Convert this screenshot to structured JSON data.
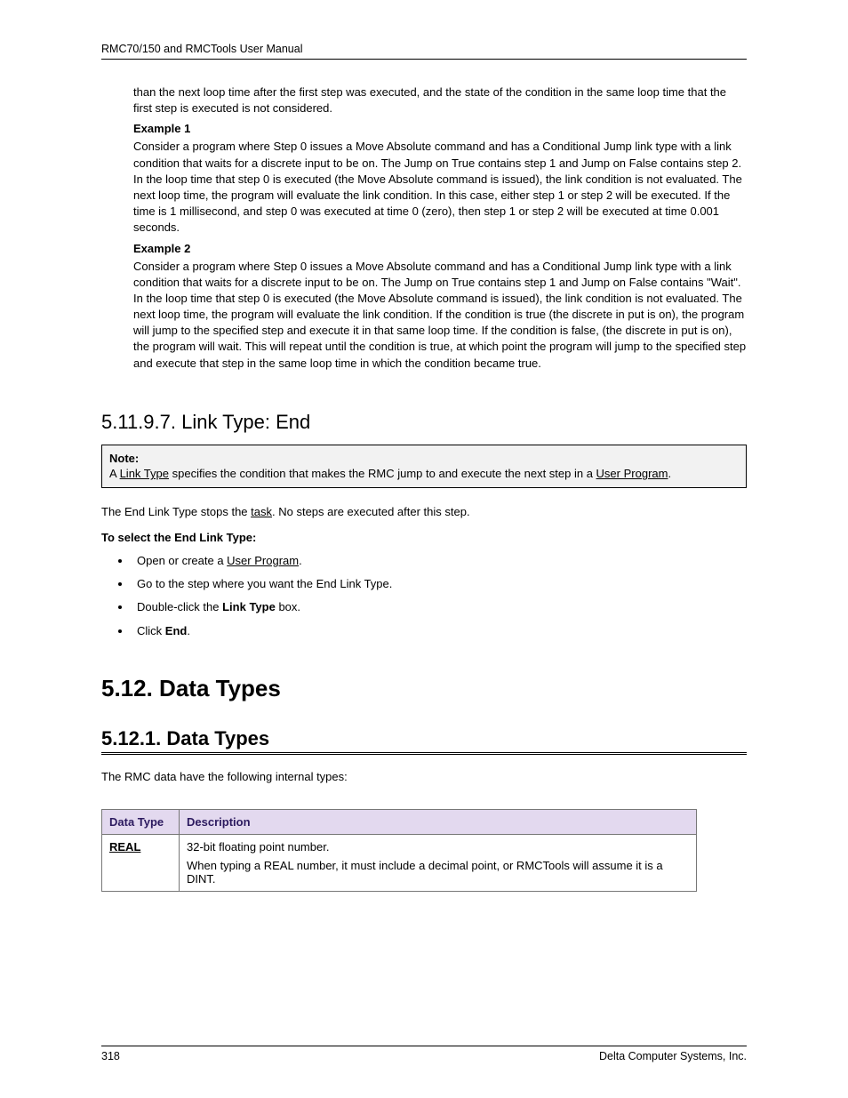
{
  "header": "RMC70/150 and RMCTools User Manual",
  "footer": {
    "page": "318",
    "company": "Delta Computer Systems, Inc."
  },
  "intro_cont": "than the next loop time after the first step was executed, and the state of the condition in the same loop time that the first step is executed is not considered.",
  "ex1_h": "Example 1",
  "ex1": "Consider a program where Step 0 issues a Move Absolute command and has a Conditional Jump link type with a link condition that waits for a discrete input to be on. The Jump on True contains step 1 and Jump on False contains step 2. In the loop time that step 0 is executed (the Move Absolute command is issued), the link condition is not evaluated. The next loop time, the program will evaluate the link condition. In this case, either step 1 or step 2 will be executed. If the time is 1 millisecond, and step 0 was executed at time 0 (zero), then step 1 or step 2 will be executed at time 0.001 seconds.",
  "ex2_h": "Example 2",
  "ex2": "Consider a program where Step 0 issues a Move Absolute command and has a Conditional Jump link type with a link condition that waits for a discrete input to be on. The Jump on True contains step 1 and Jump on False contains \"Wait\". In the loop time that step 0 is executed (the Move Absolute command is issued), the link condition is not evaluated. The next loop time, the program will evaluate the link condition. If the condition is true (the discrete in put is on), the program will jump to the specified step and execute it in that same loop time. If the condition is false, (the discrete in put is on), the program will wait. This will repeat until the condition is true, at which point the program will jump to the specified step and execute that step in the same loop time in which the condition became true.",
  "h_link_end": "5.11.9.7. Link Type: End",
  "note": {
    "label": "Note:",
    "pre": "A ",
    "link_type": "Link Type",
    "mid": " specifies the condition that makes the RMC jump to and execute the next step in a ",
    "user_program": "User Program",
    "post": "."
  },
  "end_desc": {
    "pre": "The End Link Type stops the ",
    "task": "task",
    "post": ". No steps are executed after this step."
  },
  "to_select": "To select the End Link Type:",
  "bullets": {
    "b1pre": "Open or create a ",
    "b1link": "User Program",
    "b1post": ".",
    "b2": "Go to the step where you want the End Link Type.",
    "b3pre": "Double-click the ",
    "b3b": "Link Type",
    "b3post": " box.",
    "b4pre": "Click ",
    "b4b": "End",
    "b4post": "."
  },
  "h_data_types": "5.12. Data Types",
  "h_data_types_sub": "5.12.1. Data Types",
  "dt_intro": "The RMC data have the following internal types:",
  "table": {
    "h1": "Data Type",
    "h2": "Description",
    "r1c1": "REAL",
    "r1c2a": "32-bit floating point number.",
    "r1c2b": "When typing a REAL number, it must include a decimal point, or RMCTools will assume it is a DINT."
  }
}
